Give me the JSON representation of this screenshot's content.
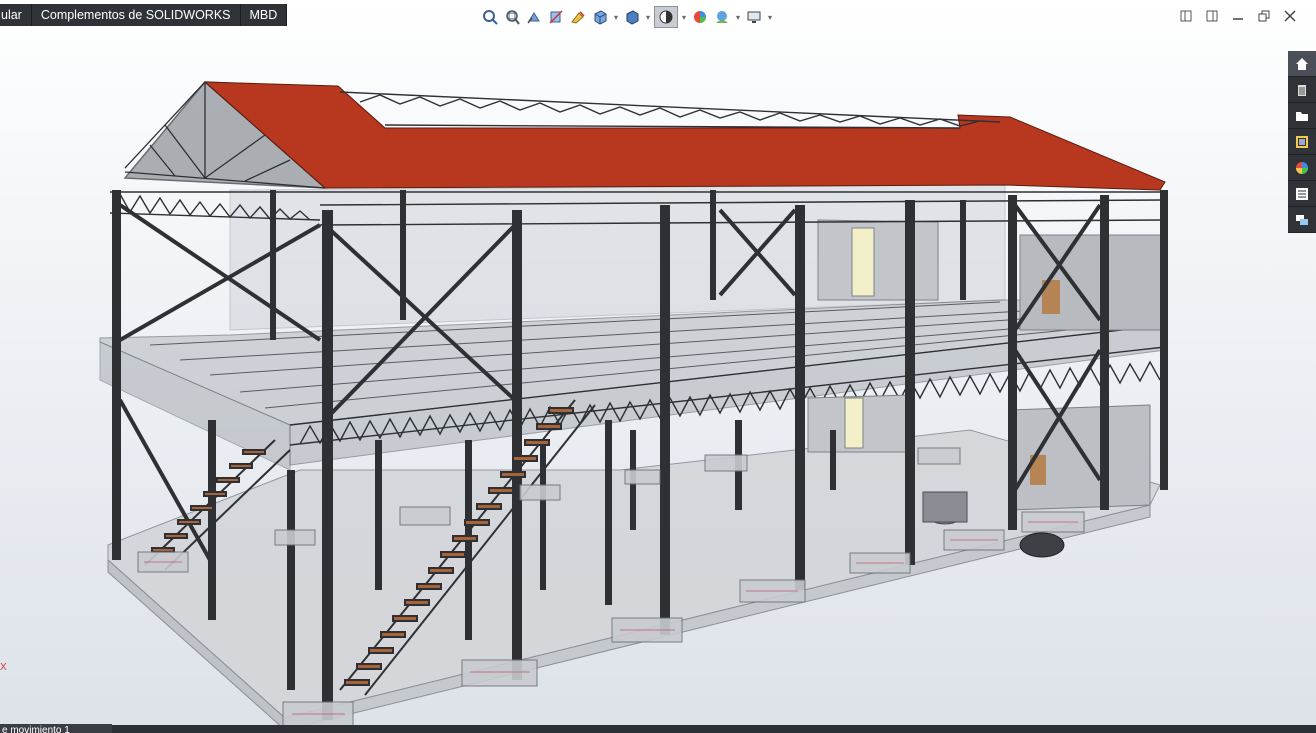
{
  "tabs": [
    {
      "label": "ular"
    },
    {
      "label": "Complementos de SOLIDWORKS"
    },
    {
      "label": "MBD"
    }
  ],
  "status": {
    "motion_tab": "e movimiento 1"
  },
  "triad": {
    "axis_label": "X"
  },
  "heads_up_icons": [
    "zoom-to-fit-icon",
    "zoom-to-area-icon",
    "previous-view-icon",
    "section-view-icon",
    "dynamic-annotation-icon",
    "view-orientation-icon",
    "display-style-icon",
    "hide-show-icon",
    "edit-appearance-icon",
    "apply-scene-icon",
    "view-settings-icon"
  ],
  "task_pane_icons": [
    "home-icon",
    "resources-icon",
    "file-explorer-icon",
    "view-palette-icon",
    "appearances-icon",
    "custom-properties-icon",
    "forum-icon"
  ],
  "colors": {
    "roof": "#b8381f",
    "steel": "#2e3034",
    "stairs": "#a5643a",
    "tab_bar": "#2f3338"
  }
}
